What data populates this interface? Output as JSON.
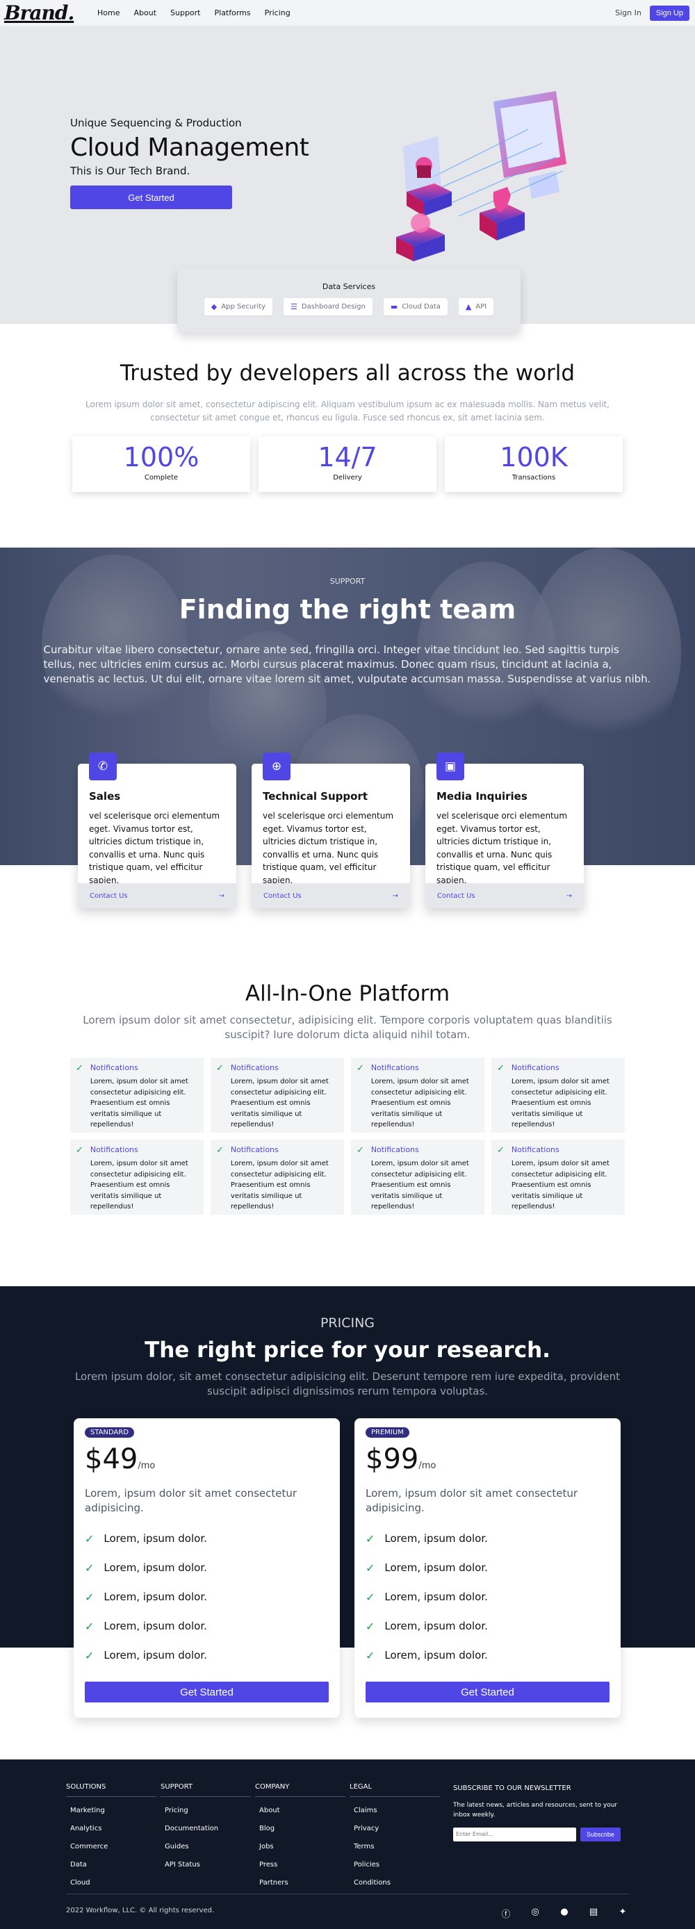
{
  "nav": {
    "brand": "Brand.",
    "links": [
      "Home",
      "About",
      "Support",
      "Platforms",
      "Pricing"
    ],
    "signin": "Sign In",
    "signup": "Sign Up"
  },
  "hero": {
    "subtitle": "Unique Sequencing & Production",
    "title": "Cloud Management",
    "tagline": "This is Our Tech Brand.",
    "cta": "Get Started",
    "services_title": "Data Services",
    "services": [
      {
        "label": "App Security",
        "icon": "layers-icon"
      },
      {
        "label": "Dashboard Design",
        "icon": "database-icon"
      },
      {
        "label": "Cloud Data",
        "icon": "server-icon"
      },
      {
        "label": "API",
        "icon": "triangle-icon"
      }
    ]
  },
  "trusted": {
    "title": "Trusted by developers all across the world",
    "body": "Lorem ipsum dolor sit amet, consectetur adipiscing elit. Aliquam vestibulum ipsum ac ex malesuada mollis. Nam metus velit, consectetur sit amet congue et, rhoncus eu ligula. Fusce sed rhoncus ex, sit amet lacinia sem.",
    "stats": [
      {
        "value": "100%",
        "label": "Complete"
      },
      {
        "value": "14/7",
        "label": "Delivery"
      },
      {
        "value": "100K",
        "label": "Transactions"
      }
    ]
  },
  "team": {
    "label": "SUPPORT",
    "title": "Finding the right team",
    "body": "Curabitur vitae libero consectetur, ornare ante sed, fringilla orci. Integer vitae tincidunt leo. Sed sagittis turpis tellus, nec ultricies enim cursus ac. Morbi cursus placerat maximus. Donec quam risus, tincidunt at lacinia a, venenatis ac lectus. Ut dui elit, ornare vitae lorem sit amet, vulputate accumsan massa. Suspendisse at varius nibh.",
    "cards": [
      {
        "title": "Sales",
        "icon": "phone-icon",
        "body": "vel scelerisque orci elementum eget. Vivamus tortor est, ultricies dictum tristique in, convallis et urna. Nunc quis tristique quam, vel efficitur sapien.",
        "link": "Contact Us"
      },
      {
        "title": "Technical Support",
        "icon": "globe-icon",
        "body": "vel scelerisque orci elementum eget. Vivamus tortor est, ultricies dictum tristique in, convallis et urna. Nunc quis tristique quam, vel efficitur sapien.",
        "link": "Contact Us"
      },
      {
        "title": "Media Inquiries",
        "icon": "chip-icon",
        "body": "vel scelerisque orci elementum eget. Vivamus tortor est, ultricies dictum tristique in, convallis et urna. Nunc quis tristique quam, vel efficitur sapien.",
        "link": "Contact Us"
      }
    ]
  },
  "platform": {
    "title": "All-In-One Platform",
    "body": "Lorem ipsum dolor sit amet consectetur, adipisicing elit. Tempore corporis voluptatem quas blanditiis suscipit? Iure dolorum dicta aliquid nihil totam.",
    "items": [
      {
        "title": "Notifications",
        "desc": "Lorem, ipsum dolor sit amet consectetur adipisicing elit. Praesentium est omnis veritatis similique ut repellendus!"
      },
      {
        "title": "Notifications",
        "desc": "Lorem, ipsum dolor sit amet consectetur adipisicing elit. Praesentium est omnis veritatis similique ut repellendus!"
      },
      {
        "title": "Notifications",
        "desc": "Lorem, ipsum dolor sit amet consectetur adipisicing elit. Praesentium est omnis veritatis similique ut repellendus!"
      },
      {
        "title": "Notifications",
        "desc": "Lorem, ipsum dolor sit amet consectetur adipisicing elit. Praesentium est omnis veritatis similique ut repellendus!"
      },
      {
        "title": "Notifications",
        "desc": "Lorem, ipsum dolor sit amet consectetur adipisicing elit. Praesentium est omnis veritatis similique ut repellendus!"
      },
      {
        "title": "Notifications",
        "desc": "Lorem, ipsum dolor sit amet consectetur adipisicing elit. Praesentium est omnis veritatis similique ut repellendus!"
      },
      {
        "title": "Notifications",
        "desc": "Lorem, ipsum dolor sit amet consectetur adipisicing elit. Praesentium est omnis veritatis similique ut repellendus!"
      },
      {
        "title": "Notifications",
        "desc": "Lorem, ipsum dolor sit amet consectetur adipisicing elit. Praesentium est omnis veritatis similique ut repellendus!"
      }
    ]
  },
  "pricing": {
    "label": "PRICING",
    "title": "The right price for your research.",
    "body": "Lorem ipsum dolor, sit amet consectetur adipisicing elit. Deserunt tempore rem iure expedita, provident suscipit adipisci dignissimos rerum tempora voluptas.",
    "plans": [
      {
        "badge": "STANDARD",
        "price": "$49",
        "period": "/mo",
        "desc": "Lorem, ipsum dolor sit amet consectetur adipisicing.",
        "features": [
          "Lorem, ipsum dolor.",
          "Lorem, ipsum dolor.",
          "Lorem, ipsum dolor.",
          "Lorem, ipsum dolor.",
          "Lorem, ipsum dolor."
        ],
        "cta": "Get Started"
      },
      {
        "badge": "PREMIUM",
        "price": "$99",
        "period": "/mo",
        "desc": "Lorem, ipsum dolor sit amet consectetur adipisicing.",
        "features": [
          "Lorem, ipsum dolor.",
          "Lorem, ipsum dolor.",
          "Lorem, ipsum dolor.",
          "Lorem, ipsum dolor.",
          "Lorem, ipsum dolor."
        ],
        "cta": "Get Started"
      }
    ]
  },
  "footer": {
    "columns": [
      {
        "heading": "SOLUTIONS",
        "links": [
          "Marketing",
          "Analytics",
          "Commerce",
          "Data",
          "Cloud"
        ]
      },
      {
        "heading": "SUPPORT",
        "links": [
          "Pricing",
          "Documentation",
          "Guides",
          "API Status"
        ]
      },
      {
        "heading": "COMPANY",
        "links": [
          "About",
          "Blog",
          "Jobs",
          "Press",
          "Partners"
        ]
      },
      {
        "heading": "LEGAL",
        "links": [
          "Claims",
          "Privacy",
          "Terms",
          "Policies",
          "Conditions"
        ]
      }
    ],
    "newsletter_title": "SUBSCRIBE TO OUR NEWSLETTER",
    "newsletter_body": "The latest news, articles and resources, sent to your inbox weekly.",
    "email_placeholder": "Enter Email...",
    "subscribe": "Subscribe",
    "copyright": "2022 Workflow, LLC. © All rights reserved.",
    "social": [
      "facebook-icon",
      "instagram-icon",
      "github-icon",
      "twitch-icon",
      "twitter-icon"
    ]
  },
  "colors": {
    "accent": "#4f46e5",
    "dark": "#111827",
    "check": "#16a34a"
  }
}
